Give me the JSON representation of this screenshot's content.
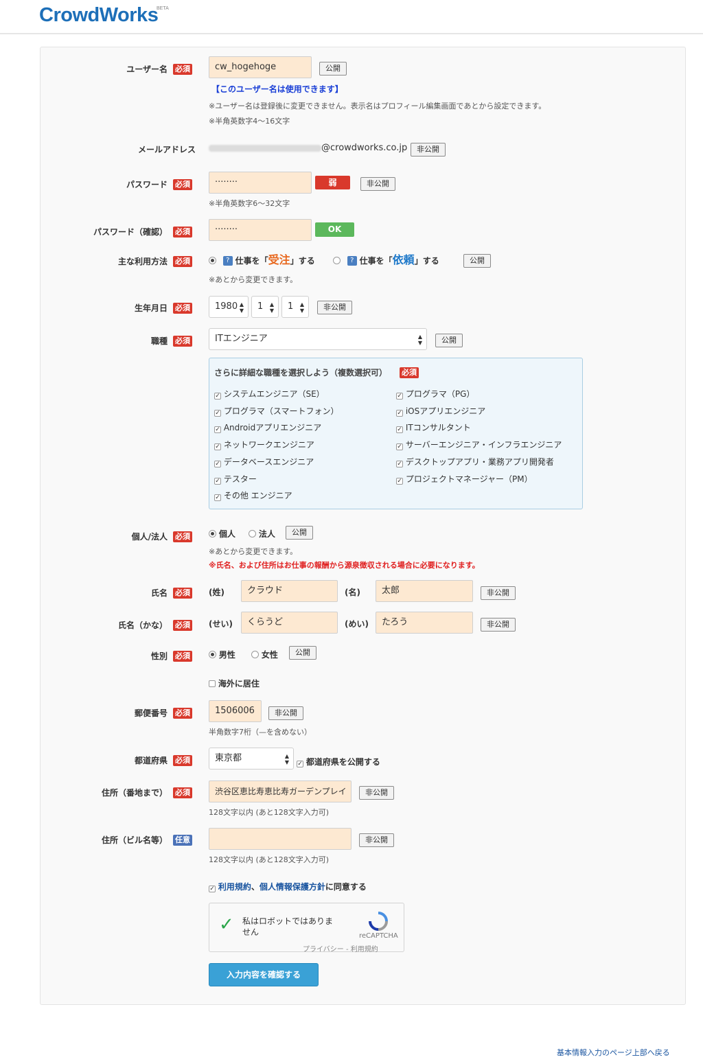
{
  "header": {
    "logo": "CrowdWorks",
    "beta": "BETA"
  },
  "badges": {
    "required": "必須",
    "optional": "任意"
  },
  "username": {
    "label": "ユーザー名",
    "value": "cw_hogehoge",
    "visibility": "公開",
    "available": "【このユーザー名は使用できます】",
    "note1": "※ユーザー名は登録後に変更できません。表示名はプロフィール編集画面であとから設定できます。",
    "note2": "※半角英数字4〜16文字"
  },
  "email": {
    "label": "メールアドレス",
    "domain": "@crowdworks.co.jp",
    "visibility": "非公開"
  },
  "password": {
    "label": "パスワード",
    "value": "········",
    "strength": "弱",
    "visibility": "非公開",
    "note": "※半角英数字6〜32文字"
  },
  "password_confirm": {
    "label": "パスワード（確認）",
    "value": "········",
    "status": "OK"
  },
  "usage": {
    "label": "主な利用方法",
    "opt1_pre": "仕事を「",
    "opt1_key": "受注",
    "opt1_post": "」する",
    "opt2_pre": "仕事を「",
    "opt2_key": "依頼",
    "opt2_post": "」する",
    "help": "?",
    "visibility": "公開",
    "note": "※あとから変更できます。"
  },
  "birthday": {
    "label": "生年月日",
    "year": "1980",
    "month": "1",
    "day": "1",
    "visibility": "非公開"
  },
  "job": {
    "label": "職種",
    "value": "ITエンジニア",
    "visibility": "公開",
    "detail_title": "さらに詳細な職種を選択しよう（複数選択可）",
    "items_left": [
      "システムエンジニア（SE）",
      "プログラマ（スマートフォン）",
      "Androidアプリエンジニア",
      "ネットワークエンジニア",
      "データベースエンジニア",
      "テスター",
      "その他 エンジニア"
    ],
    "items_right": [
      "プログラマ（PG）",
      "iOSアプリエンジニア",
      "ITコンサルタント",
      "サーバーエンジニア・インフラエンジニア",
      "デスクトップアプリ・業務アプリ開発者",
      "プロジェクトマネージャー（PM）"
    ]
  },
  "entity": {
    "label": "個人/法人",
    "opt1": "個人",
    "opt2": "法人",
    "visibility": "公開",
    "note": "※あとから変更できます。",
    "warning": "※氏名、および住所はお仕事の報酬から源泉徴収される場合に必要になります。"
  },
  "name": {
    "label": "氏名",
    "last_label": "(姓)",
    "last": "クラウド",
    "first_label": "(名)",
    "first": "太郎",
    "visibility": "非公開"
  },
  "kana": {
    "label": "氏名（かな）",
    "last_label": "(せい)",
    "last": "くらうど",
    "first_label": "(めい)",
    "first": "たろう",
    "visibility": "非公開"
  },
  "gender": {
    "label": "性別",
    "opt1": "男性",
    "opt2": "女性",
    "visibility": "公開"
  },
  "overseas": {
    "label": "海外に居住"
  },
  "postal": {
    "label": "郵便番号",
    "value": "1506006",
    "visibility": "非公開",
    "note": "半角数字7桁（—を含めない）"
  },
  "prefecture": {
    "label": "都道府県",
    "value": "東京都",
    "publish": "都道府県を公開する"
  },
  "address1": {
    "label": "住所（番地まで）",
    "value": "渋谷区恵比寿恵比寿ガーデンプレイ",
    "visibility": "非公開",
    "note": "128文字以内 (あと128文字入力可)"
  },
  "address2": {
    "label": "住所（ビル名等）",
    "value": "",
    "visibility": "非公開",
    "note": "128文字以内 (あと128文字入力可)"
  },
  "agree": {
    "link1": "利用規約",
    "sep": "、",
    "link2": "個人情報保護方針",
    "suffix": "に同意する"
  },
  "captcha": {
    "text": "私はロボットではありません",
    "brand": "reCAPTCHA",
    "links": "プライバシー - 利用規約"
  },
  "submit": "入力内容を確認する",
  "footer_link": "基本情報入力のページ上部へ戻る",
  "colors": {
    "brand": "#1d6fb8",
    "required": "#d9392c",
    "optional": "#4b72b8",
    "field": "#fde9d2",
    "ok": "#5cb85c",
    "weak": "#d9392c",
    "accent_orange": "#e8681e",
    "accent_blue": "#1d78c9",
    "warning": "#e02020",
    "link": "#1a55a0",
    "submit": "#3aa1d6"
  }
}
